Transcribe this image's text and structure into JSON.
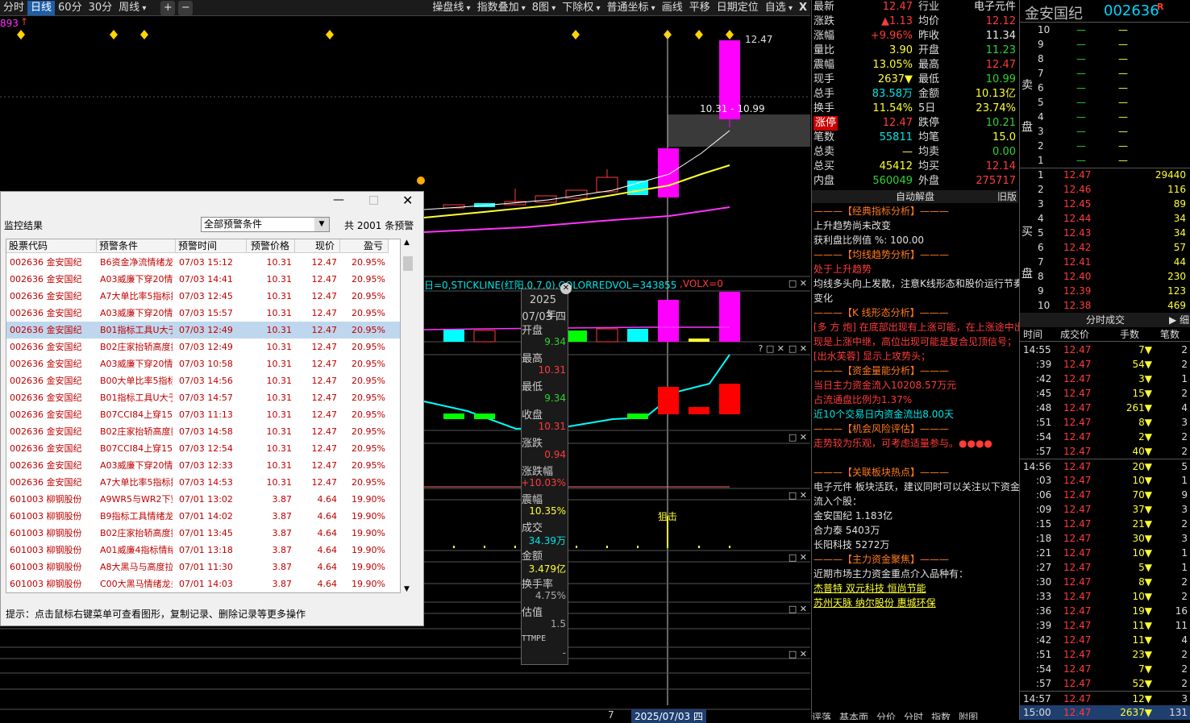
{
  "toolbar": {
    "left": [
      "分时",
      "日线",
      "60分",
      "30分",
      "周线"
    ],
    "plus": "+",
    "minus": "−",
    "right": [
      "操盘线",
      "指数叠加",
      "8图",
      "下除权",
      "普通坐标"
    ],
    "right2": [
      "画线",
      "平移",
      "日期定位",
      "自选"
    ],
    "close": "X"
  },
  "chart": {
    "price_top": "12.47",
    "price_range": "10.31 - 10.99",
    "left_val": "893",
    "indicator_line": "日=0,STICKLINE(红阳,0,7,0),COLORREDVOL=343855",
    "indicator_tail": ",VOLX=0",
    "jump_label": "狙击",
    "date_label": "2025/07/03 四",
    "date_left": "7"
  },
  "popup": {
    "year": "2025年",
    "date": "07/03 四",
    "items": [
      {
        "l": "开盘",
        "v": "9.34",
        "c": "green"
      },
      {
        "l": "最高",
        "v": "10.31",
        "c": "red"
      },
      {
        "l": "最低",
        "v": "9.34",
        "c": "green"
      },
      {
        "l": "收盘",
        "v": "10.31",
        "c": "red"
      },
      {
        "l": "涨跌",
        "v": "0.94",
        "c": "red"
      },
      {
        "l": "涨跌幅",
        "v": "+10.03%",
        "c": "red"
      },
      {
        "l": "震幅",
        "v": "10.35%",
        "c": "yellow"
      },
      {
        "l": "成交",
        "v": "34.39万",
        "c": "cyan"
      },
      {
        "l": "金额",
        "v": "3.479亿",
        "c": "yellow"
      },
      {
        "l": "换手率",
        "v": "4.75%",
        "c": "gray"
      },
      {
        "l": "估值",
        "v": "1.5",
        "c": "gray"
      }
    ],
    "tail": "TTMPE",
    "tail_v": "-"
  },
  "quote": {
    "header_right": "电子元件",
    "rows": [
      {
        "l": "最新",
        "v": "12.47",
        "vc": "red",
        "l2": "行业",
        "v2": "电子元件",
        "v2c": "white"
      },
      {
        "l": "涨跌",
        "v": "▲1.13",
        "vc": "red",
        "l2": "均价",
        "v2": "12.12",
        "v2c": "red"
      },
      {
        "l": "涨幅",
        "v": "+9.96%",
        "vc": "red",
        "l2": "昨收",
        "v2": "11.34",
        "v2c": "white"
      },
      {
        "l": "量比",
        "v": "3.90",
        "vc": "yellow",
        "l2": "开盘",
        "v2": "11.23",
        "v2c": "green"
      },
      {
        "l": "震幅",
        "v": "13.05%",
        "vc": "yellow",
        "l2": "最高",
        "v2": "12.47",
        "v2c": "red"
      },
      {
        "l": "现手",
        "v": "2637▼",
        "vc": "yellow",
        "l2": "最低",
        "v2": "10.99",
        "v2c": "green"
      },
      {
        "l": "总手",
        "v": "83.58万",
        "vc": "cyan",
        "l2": "金额",
        "v2": "10.13亿",
        "v2c": "yellow"
      },
      {
        "l": "换手",
        "v": "11.54%",
        "vc": "yellow",
        "l2": "5日",
        "v2": "23.74%",
        "v2c": "yellow"
      },
      {
        "l": "涨停",
        "v": "12.47",
        "vc": "red",
        "l2": "跌停",
        "v2": "10.21",
        "v2c": "green"
      },
      {
        "l": "笔数",
        "v": "55811",
        "vc": "cyan",
        "l2": "均笔",
        "v2": "15.0",
        "v2c": "yellow"
      },
      {
        "l": "总卖",
        "v": "—",
        "vc": "yellow",
        "l2": "均卖",
        "v2": "0.00",
        "v2c": "green"
      },
      {
        "l": "总买",
        "v": "45412",
        "vc": "yellow",
        "l2": "均买",
        "v2": "12.14",
        "v2c": "red"
      },
      {
        "l": "内盘",
        "v": "560049",
        "vc": "green",
        "l2": "外盘",
        "v2": "275717",
        "v2c": "red"
      }
    ]
  },
  "analysis": {
    "title": "自动解盘",
    "title_right": "旧版",
    "lines": [
      {
        "t": "———【经典指标分析】———",
        "c": "orange"
      },
      {
        "t": "上升趋势尚未改变",
        "c": "white"
      },
      {
        "t": "获利盘比例值 %: 100.00",
        "c": "white"
      },
      {
        "t": "———【均线趋势分析】———",
        "c": "orange"
      },
      {
        "t": "处于上升趋势",
        "c": "red"
      },
      {
        "t": "均线多头向上发散，注意K线形态和股价运行节奏",
        "c": "white"
      },
      {
        "t": "变化",
        "c": "white"
      },
      {
        "t": "———【K 线形态分析】———",
        "c": "orange"
      },
      {
        "t": "[多 方 炮] 在底部出现有上涨可能，在上涨途中出",
        "c": "red"
      },
      {
        "t": "现是上涨中继，高位出现可能是复合见顶信号；",
        "c": "red"
      },
      {
        "t": "[出水芙蓉] 显示上攻势头；",
        "c": "red"
      },
      {
        "t": "———【资金量能分析】———",
        "c": "orange"
      },
      {
        "t": "当日主力资金流入10208.57万元",
        "c": "red"
      },
      {
        "t": "占流通盘比例为1.37%",
        "c": "red"
      },
      {
        "t": "近10个交易日内资金流出8.00天",
        "c": "cyan"
      },
      {
        "t": "———【机会风险评估】———",
        "c": "orange"
      },
      {
        "t": "走势较为乐观，可考虑适量参与。●●●●",
        "c": "red"
      },
      {
        "t": "",
        "c": "white"
      },
      {
        "t": "———【关联板块热点】———",
        "c": "orange"
      },
      {
        "t": "电子元件 板块活跃，建议同时可以关注以下资金",
        "c": "white"
      },
      {
        "t": "流入个股：",
        "c": "white"
      },
      {
        "t": "金安国纪 1.183亿",
        "c": "white"
      },
      {
        "t": "合力泰 5403万",
        "c": "white"
      },
      {
        "t": "长阳科技 5272万",
        "c": "white"
      },
      {
        "t": "———【主力资金聚焦】———",
        "c": "orange"
      },
      {
        "t": "近期市场主力资金重点介入品种有：",
        "c": "white"
      },
      {
        "t": "杰普特 双元科技 恒尚节能",
        "c": "yellow"
      },
      {
        "t": "苏州天脉 纳尔股份 惠城环保",
        "c": "yellow"
      }
    ],
    "bottom_tabs": [
      "评落",
      "基本面",
      "分价",
      "分时",
      "指数",
      "附图"
    ]
  },
  "stock": {
    "name": "金安国纪",
    "code": "002636",
    "badge": "R"
  },
  "orderbook": {
    "sell_label": "卖盘",
    "buy_label": "买盘",
    "sell": [
      {
        "n": "10"
      },
      {
        "n": "9"
      },
      {
        "n": "8"
      },
      {
        "n": "7"
      },
      {
        "n": "6"
      },
      {
        "n": "5"
      },
      {
        "n": "4"
      },
      {
        "n": "3"
      },
      {
        "n": "2"
      },
      {
        "n": "1"
      }
    ],
    "buy": [
      {
        "n": "1",
        "p": "12.47",
        "q": "29440"
      },
      {
        "n": "2",
        "p": "12.46",
        "q": "116"
      },
      {
        "n": "3",
        "p": "12.45",
        "q": "89"
      },
      {
        "n": "4",
        "p": "12.44",
        "q": "34"
      },
      {
        "n": "5",
        "p": "12.43",
        "q": "34"
      },
      {
        "n": "6",
        "p": "12.42",
        "q": "57"
      },
      {
        "n": "7",
        "p": "12.41",
        "q": "44"
      },
      {
        "n": "8",
        "p": "12.40",
        "q": "230"
      },
      {
        "n": "9",
        "p": "12.39",
        "q": "123"
      },
      {
        "n": "10",
        "p": "12.38",
        "q": "469"
      }
    ],
    "dash": "—"
  },
  "trades": {
    "title": "分时成交",
    "detail": "细",
    "headers": [
      "时间",
      "成交价",
      "手数",
      "笔数"
    ],
    "rows": [
      [
        "14:55",
        "12.47",
        "7▼",
        "2"
      ],
      [
        ":39",
        "12.47",
        "54▼",
        "2"
      ],
      [
        ":42",
        "12.47",
        "3▼",
        "1"
      ],
      [
        ":45",
        "12.47",
        "15▼",
        "2"
      ],
      [
        ":48",
        "12.47",
        "261▼",
        "4"
      ],
      [
        ":51",
        "12.47",
        "8▼",
        "3"
      ],
      [
        ":54",
        "12.47",
        "2▼",
        "2"
      ],
      [
        ":57",
        "12.47",
        "40▼",
        "2"
      ],
      [
        "14:56",
        "12.47",
        "20▼",
        "5"
      ],
      [
        ":03",
        "12.47",
        "10▼",
        "1"
      ],
      [
        ":06",
        "12.47",
        "70▼",
        "9"
      ],
      [
        ":09",
        "12.47",
        "37▼",
        "3"
      ],
      [
        ":15",
        "12.47",
        "21▼",
        "2"
      ],
      [
        ":18",
        "12.47",
        "30▼",
        "3"
      ],
      [
        ":21",
        "12.47",
        "10▼",
        "1"
      ],
      [
        ":27",
        "12.47",
        "5▼",
        "1"
      ],
      [
        ":30",
        "12.47",
        "8▼",
        "2"
      ],
      [
        ":33",
        "12.47",
        "10▼",
        "2"
      ],
      [
        ":36",
        "12.47",
        "19▼",
        "16"
      ],
      [
        ":39",
        "12.47",
        "11▼",
        "11"
      ],
      [
        ":42",
        "12.47",
        "11▼",
        "4"
      ],
      [
        ":51",
        "12.47",
        "23▼",
        "2"
      ],
      [
        ":54",
        "12.47",
        "7▼",
        "2"
      ],
      [
        ":57",
        "12.47",
        "52▼",
        "2"
      ],
      [
        "14:57",
        "12.47",
        "12▼",
        "3"
      ],
      [
        "15:00",
        "12.47",
        "2637▼",
        "131"
      ]
    ]
  },
  "monitor": {
    "title": "监控结果",
    "select": "全部预警条件",
    "count_prefix": "共",
    "count": "2001",
    "count_suffix": "条预警",
    "headers": [
      "股票代码",
      "预警条件",
      "预警时间",
      "预警价格",
      "现价",
      "盈亏"
    ],
    "rows": [
      [
        "002636 金安国纪",
        "B6资金净流情绪龙",
        "07/03 15:12",
        "10.31",
        "12.47",
        "20.95%"
      ],
      [
        "002636 金安国纪",
        "A03威廉下穿20情绪",
        "07/03 14:41",
        "10.31",
        "12.47",
        "20.95%"
      ],
      [
        "002636 金安国纪",
        "A7大单比率5指标提",
        "07/03 12:45",
        "10.31",
        "12.47",
        "20.95%"
      ],
      [
        "002636 金安国纪",
        "A03威廉下穿20情绪",
        "07/03 15:57",
        "10.31",
        "12.47",
        "20.95%"
      ],
      [
        "002636 金安国纪",
        "B01指标工具U大于",
        "07/03 12:49",
        "10.31",
        "12.47",
        "20.95%"
      ],
      [
        "002636 金安国纪",
        "B02庄家抬轿高度拉",
        "07/03 12:49",
        "10.31",
        "12.47",
        "20.95%"
      ],
      [
        "002636 金安国纪",
        "A03威廉下穿20情绪",
        "07/03 10:58",
        "10.31",
        "12.47",
        "20.95%"
      ],
      [
        "002636 金安国纪",
        "B00大单比率5指标",
        "07/03 14:56",
        "10.31",
        "12.47",
        "20.95%"
      ],
      [
        "002636 金安国纪",
        "B01指标工具U大于",
        "07/03 14:57",
        "10.31",
        "12.47",
        "20.95%"
      ],
      [
        "002636 金安国纪",
        "B07CCI84上穿150",
        "07/03 11:13",
        "10.31",
        "12.47",
        "20.95%"
      ],
      [
        "002636 金安国纪",
        "B02庄家抬轿高度拉",
        "07/03 14:58",
        "10.31",
        "12.47",
        "20.95%"
      ],
      [
        "002636 金安国纪",
        "B07CCI84上穿150",
        "07/03 12:54",
        "10.31",
        "12.47",
        "20.95%"
      ],
      [
        "002636 金安国纪",
        "A03威廉下穿20情绪",
        "07/03 12:33",
        "10.31",
        "12.47",
        "20.95%"
      ],
      [
        "002636 金安国纪",
        "A7大单比率5指标提",
        "07/03 14:53",
        "10.31",
        "12.47",
        "20.95%"
      ],
      [
        "601003 柳钢股份",
        "A9WR5与WR2下穿20",
        "07/01 13:02",
        "3.87",
        "4.64",
        "19.90%"
      ],
      [
        "601003 柳钢股份",
        "B9指标工具情绪龙",
        "07/01 14:02",
        "3.87",
        "4.64",
        "19.90%"
      ],
      [
        "601003 柳钢股份",
        "B02庄家抬轿高度拉",
        "07/01 13:45",
        "3.87",
        "4.64",
        "19.90%"
      ],
      [
        "601003 柳钢股份",
        "A01威廉4指标情绪",
        "07/01 13:18",
        "3.87",
        "4.64",
        "19.90%"
      ],
      [
        "601003 柳钢股份",
        "A8大黑马与高度拉",
        "07/01 11:30",
        "3.87",
        "4.64",
        "19.90%"
      ],
      [
        "601003 柳钢股份",
        "C00大黑马情绪龙头",
        "07/01 14:03",
        "3.87",
        "4.64",
        "19.90%"
      ]
    ],
    "hint": "提示：点击鼠标右键菜单可查看图形，复制记录、删除记录等更多操作"
  }
}
